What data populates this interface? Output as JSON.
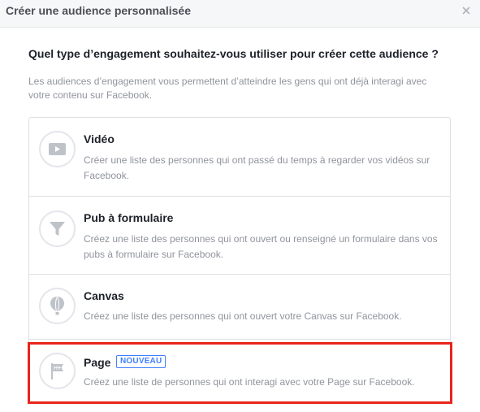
{
  "dialog": {
    "title": "Créer une audience personnalisée",
    "close_label": "×"
  },
  "question": "Quel type d’engagement souhaitez-vous utiliser pour créer cette audience ?",
  "description": "Les audiences d’engagement vous permettent d’atteindre les gens qui ont déjà interagi avec votre contenu sur Facebook.",
  "options": [
    {
      "title": "Vidéo",
      "icon": "video-icon",
      "description": "Créer une liste des personnes qui ont passé du temps à regarder vos vidéos sur Facebook."
    },
    {
      "title": "Pub à formulaire",
      "icon": "funnel-icon",
      "description": "Créez une liste des personnes qui ont ouvert ou renseigné un formulaire dans vos pubs à formulaire sur Facebook."
    },
    {
      "title": "Canvas",
      "icon": "canvas-balloon-icon",
      "description": "Créez une liste des personnes qui ont ouvert votre Canvas sur Facebook."
    },
    {
      "title": "Page",
      "icon": "flag-icon",
      "badge": "NOUVEAU",
      "description": "Créez une liste de personnes qui ont interagi avec votre Page sur Facebook."
    }
  ],
  "colors": {
    "highlight": "#e8251c",
    "badge": "#4080ff",
    "muted_text": "#90949c"
  }
}
